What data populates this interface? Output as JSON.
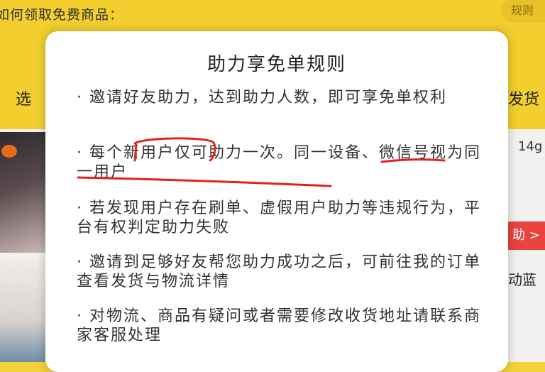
{
  "background": {
    "question_text": "如何领取免费商品：",
    "rules_button": "规则",
    "step_left": "选",
    "step_right": "发货",
    "price_right": "14g",
    "red_button": "助 >",
    "blue_text": "动蓝"
  },
  "modal": {
    "title": "助力享免单规则",
    "rules": [
      {
        "text": "· 邀请好友助力，达到助力人数，即可享免单权利"
      },
      {
        "prefix": "· 每个",
        "highlight1": "新用户",
        "middle": "仅可助力一次。",
        "highlight2": "同一设备、微信号视为同一用户"
      },
      {
        "text": "· 若发现用户存在刷单、虚假用户助力等违规行为，平台有权判定助力失败"
      },
      {
        "text": "· 邀请到足够好友帮您助力成功之后，可前往我的订单查看发货与物流详情"
      },
      {
        "text": "· 对物流、商品有疑问或者需要修改收货地址请联系商家客服处理"
      }
    ]
  },
  "annotation_color": "#e0231f"
}
